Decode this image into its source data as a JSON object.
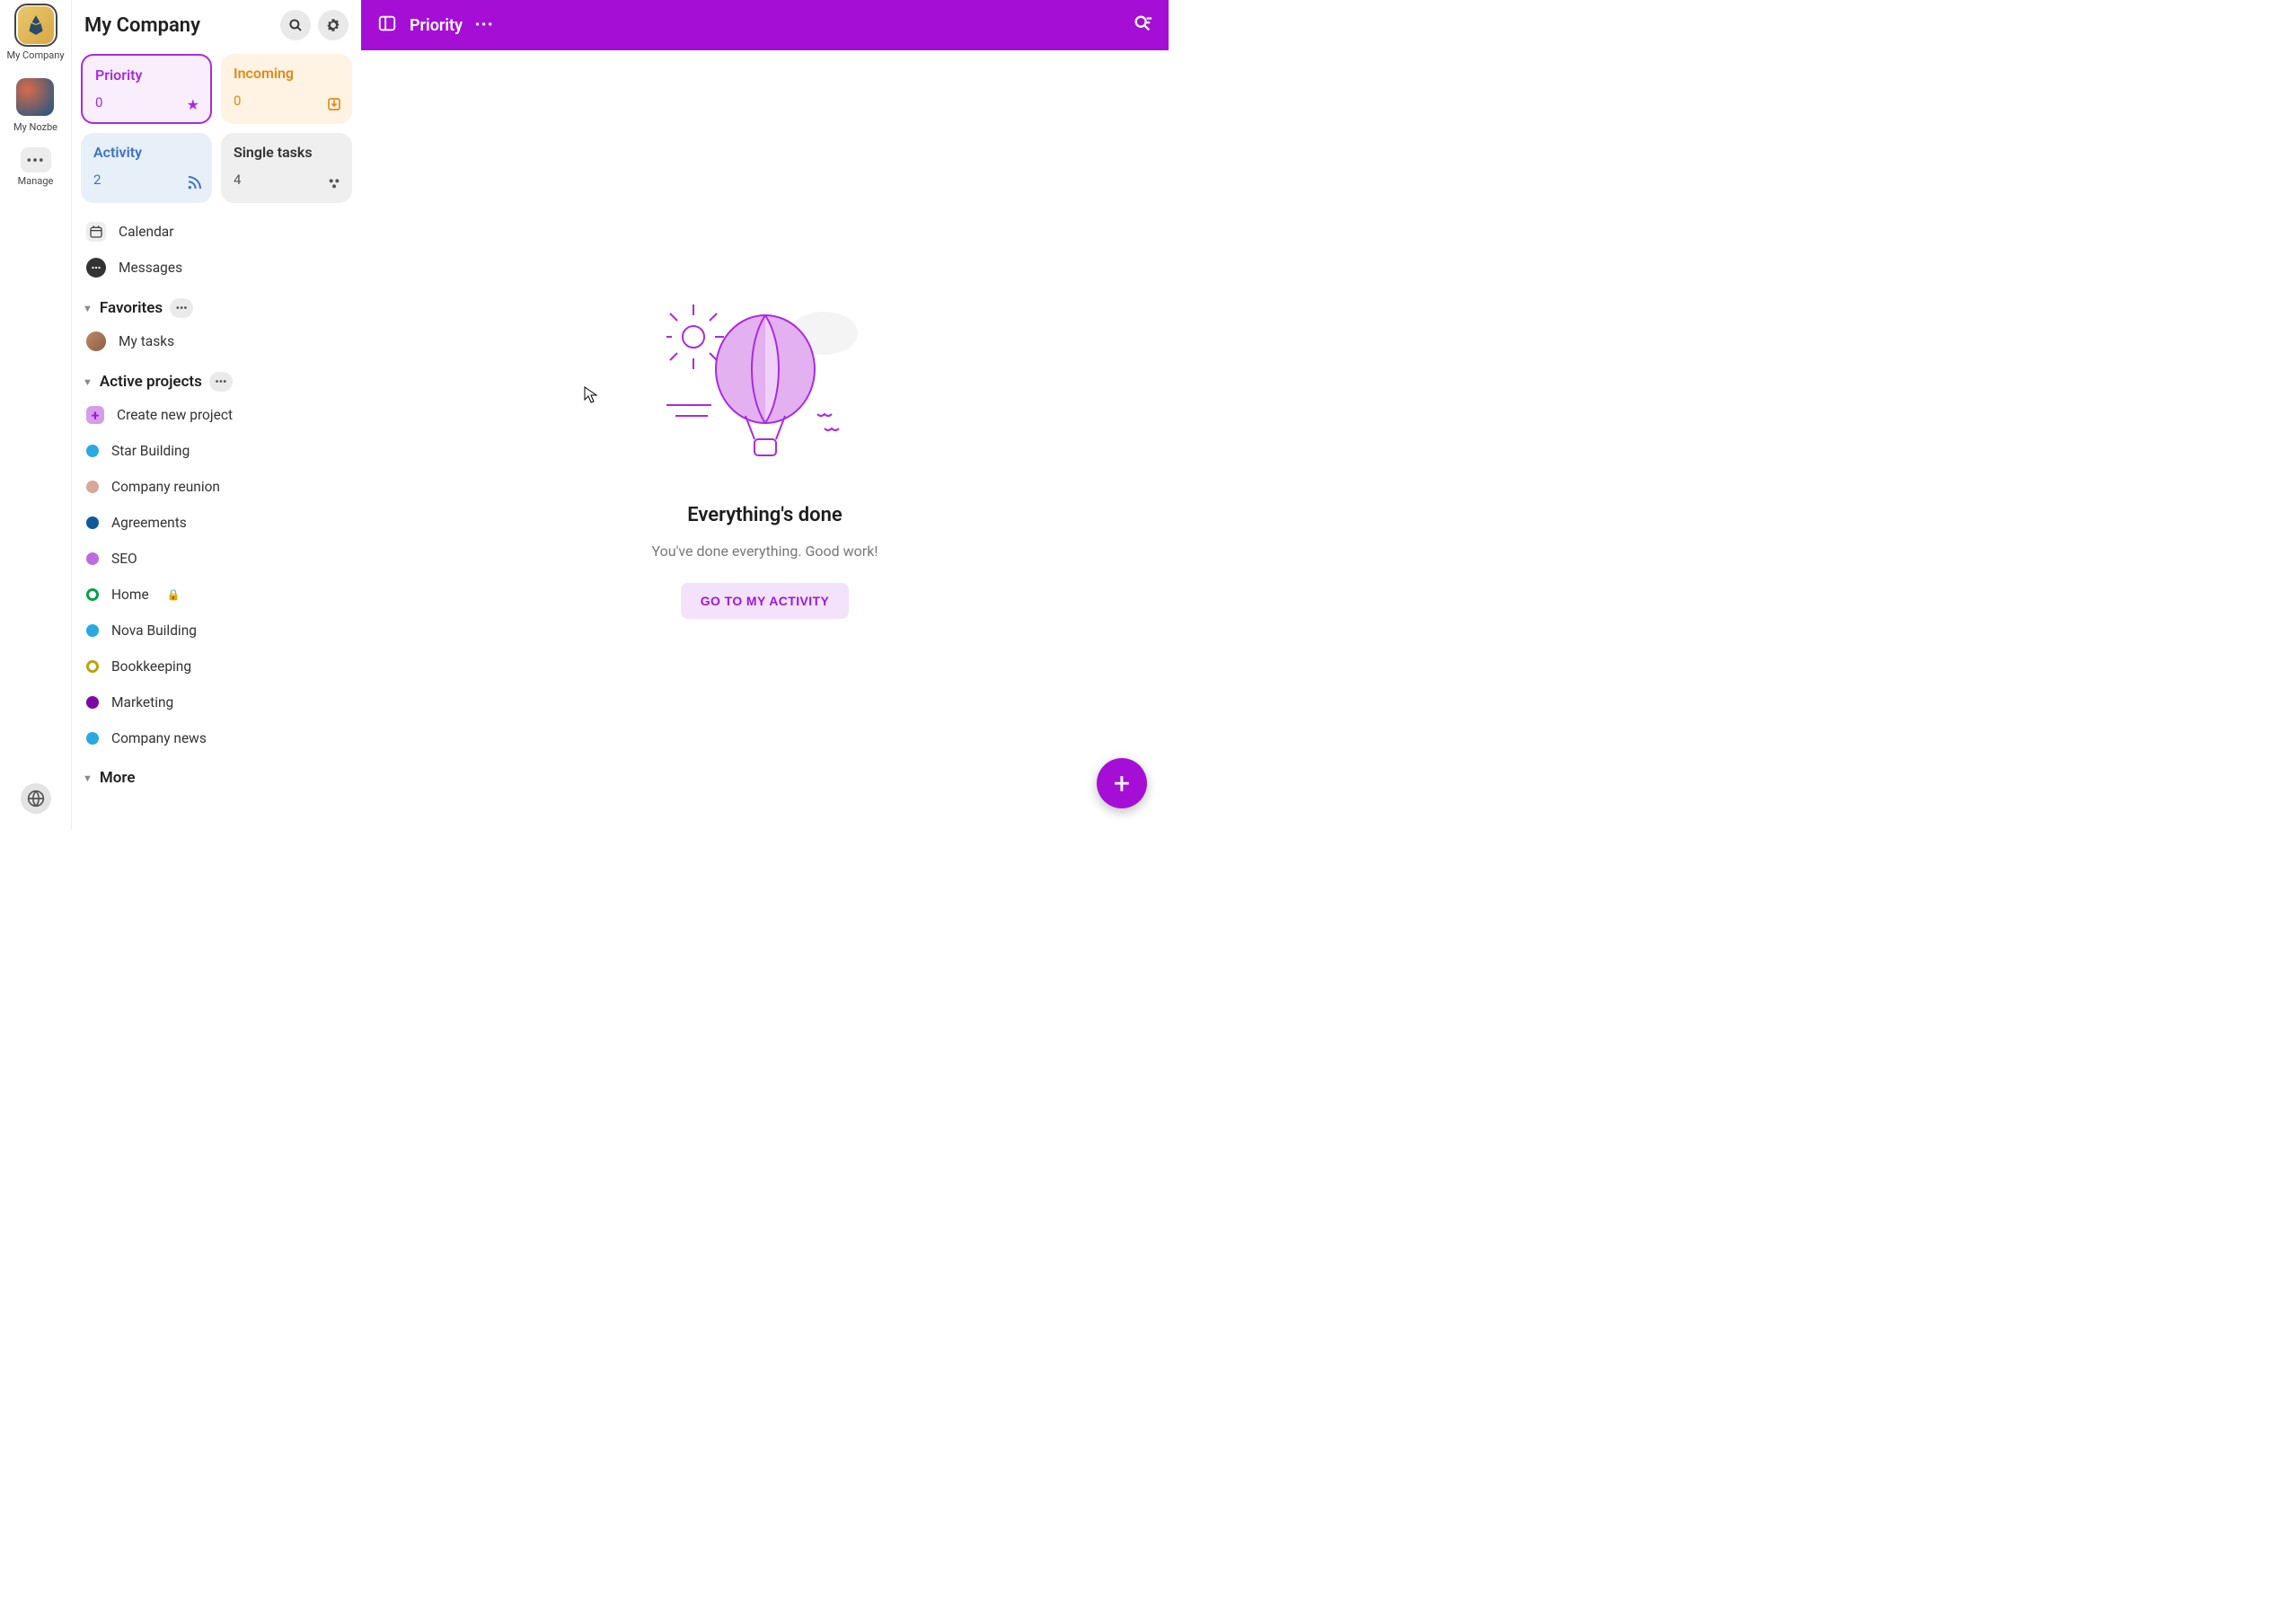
{
  "rail": {
    "items": [
      {
        "label": "My Company",
        "active": true
      },
      {
        "label": "My Nozbe"
      },
      {
        "label": "Manage",
        "type": "manage"
      }
    ]
  },
  "sidebar": {
    "title": "My Company",
    "cards": {
      "priority": {
        "title": "Priority",
        "count": "0"
      },
      "incoming": {
        "title": "Incoming",
        "count": "0"
      },
      "activity": {
        "title": "Activity",
        "count": "2"
      },
      "single": {
        "title": "Single tasks",
        "count": "4"
      }
    },
    "quick": [
      {
        "label": "Calendar",
        "icon": "calendar"
      },
      {
        "label": "Messages",
        "icon": "messages"
      }
    ],
    "favorites": {
      "title": "Favorites",
      "items": [
        {
          "label": "My tasks",
          "icon": "avatar"
        }
      ]
    },
    "projects": {
      "title": "Active projects",
      "create_label": "Create new project",
      "items": [
        {
          "label": "Star Building",
          "color": "#2aa9e0"
        },
        {
          "label": "Company reunion",
          "color": "#d8a69a"
        },
        {
          "label": "Agreements",
          "color": "#0f5a9a"
        },
        {
          "label": "SEO",
          "color": "#c06bdd"
        },
        {
          "label": "Home",
          "color": "#0aa04a",
          "ring": true,
          "locked": true
        },
        {
          "label": "Nova Building",
          "color": "#2aa9e0"
        },
        {
          "label": "Bookkeeping",
          "color": "#b8a316",
          "ring": true
        },
        {
          "label": "Marketing",
          "color": "#7b0aa0"
        },
        {
          "label": "Company news",
          "color": "#2aa9e0"
        }
      ]
    },
    "more_title": "More"
  },
  "topbar": {
    "title": "Priority"
  },
  "empty": {
    "title": "Everything's done",
    "subtitle": "You've done everything. Good work!",
    "cta": "GO TO MY ACTIVITY"
  }
}
